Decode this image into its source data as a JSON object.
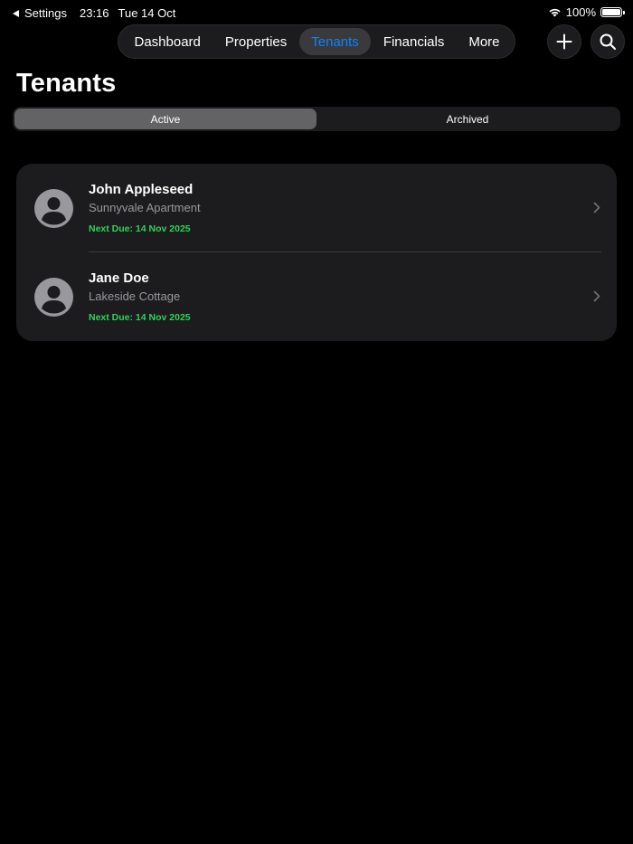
{
  "status_bar": {
    "back_label": "Settings",
    "time": "23:16",
    "date": "Tue 14 Oct",
    "battery_percent": "100%",
    "battery_level": 1.0
  },
  "tabs": [
    {
      "label": "Dashboard",
      "active": false
    },
    {
      "label": "Properties",
      "active": false
    },
    {
      "label": "Tenants",
      "active": true
    },
    {
      "label": "Financials",
      "active": false
    },
    {
      "label": "More",
      "active": false
    }
  ],
  "toolbar": {
    "add_icon": "plus-icon",
    "search_icon": "search-icon"
  },
  "page_title": "Tenants",
  "segmented": {
    "options": [
      "Active",
      "Archived"
    ],
    "selected": "Active"
  },
  "tenants": [
    {
      "name": "John Appleseed",
      "property": "Sunnyvale Apartment",
      "next_due": "Next Due: 14 Nov 2025"
    },
    {
      "name": "Jane Doe",
      "property": "Lakeside Cottage",
      "next_due": "Next Due: 14 Nov 2025"
    }
  ],
  "colors": {
    "background": "#000000",
    "card": "#1c1c1e",
    "accent": "#0a84ff",
    "due_green": "#30d158",
    "secondary_text": "#98989d"
  }
}
